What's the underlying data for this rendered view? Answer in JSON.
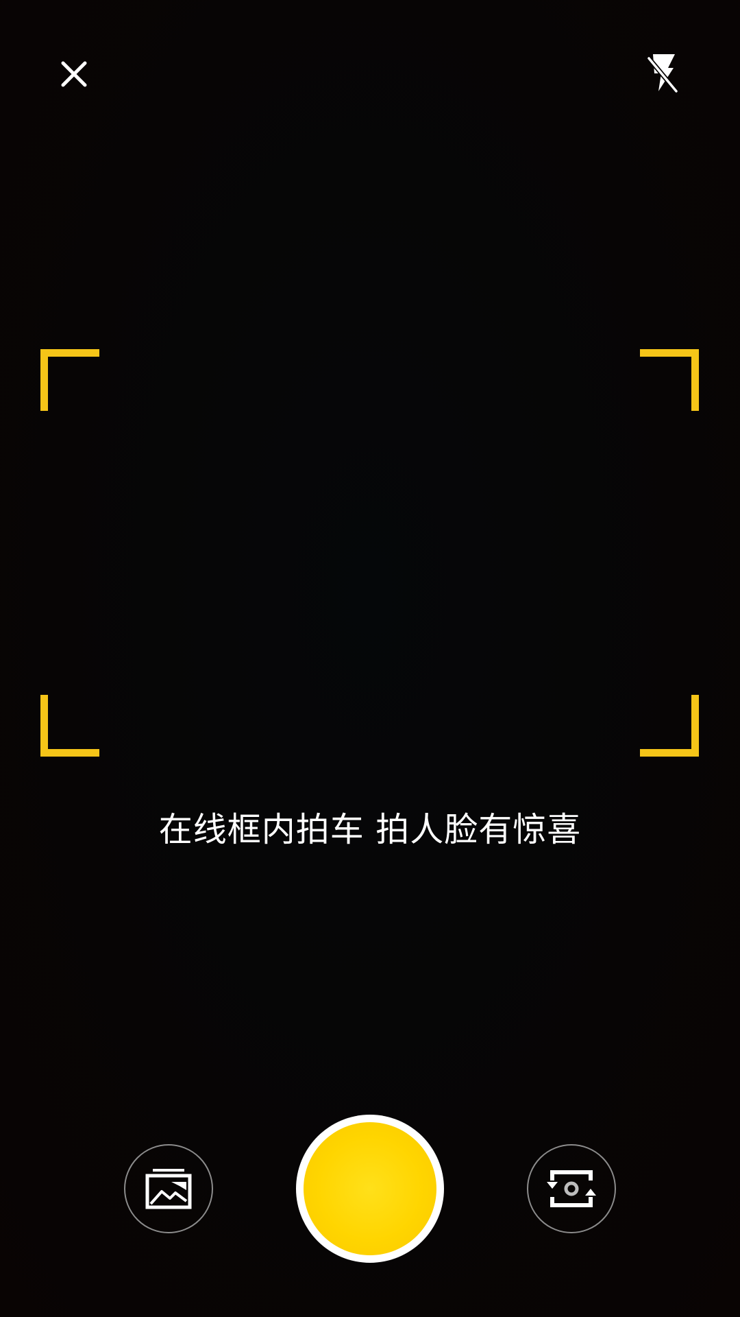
{
  "top_bar": {
    "close_icon": "close-icon",
    "flash_icon": "flash-off-icon"
  },
  "viewfinder": {
    "frame_color": "#f5c518",
    "hint_text": "在线框内拍车 拍人脸有惊喜"
  },
  "bottom_bar": {
    "gallery_icon": "gallery-icon",
    "shutter_color": "#ffd500",
    "switch_camera_icon": "switch-camera-icon"
  }
}
